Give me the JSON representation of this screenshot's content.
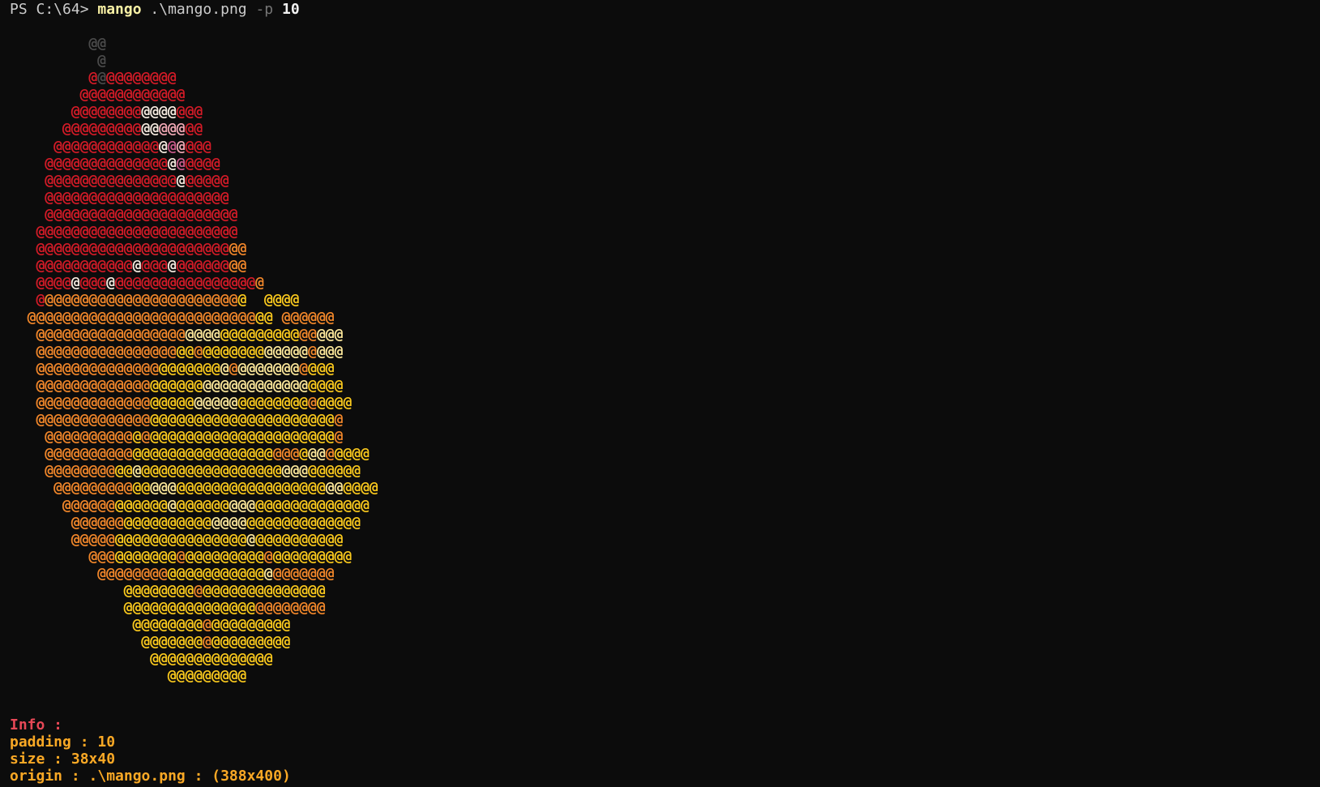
{
  "prompt": {
    "path": "PS C:\\64> ",
    "command": "mango",
    "arg": ".\\mango.png",
    "flag": "-p",
    "value": "10"
  },
  "colors": {
    "background": "#0c0c0c",
    "grey": "#555555",
    "red": "#d7191e",
    "pink": "#e89aa2",
    "orange": "#f28c1e",
    "yellow": "#fcd116",
    "light": "#fff3d6"
  },
  "ascii_art": {
    "char": "@",
    "palette": {
      "g": "#4a4a4a",
      "r": "#d21b27",
      "p": "#f0a8b4",
      "m": "#c95a8a",
      "w": "#f5eadf",
      "o": "#f0862a",
      "y": "#f9c81d",
      "L": "#fce79a"
    },
    "rows": [
      {
        "indent": 9,
        "cells": "gg"
      },
      {
        "indent": 10,
        "cells": "g"
      },
      {
        "indent": 9,
        "cells": "rgrrrrrrrr"
      },
      {
        "indent": 8,
        "cells": "rrrrrrrrrrrr"
      },
      {
        "indent": 7,
        "cells": "rrrrrrrrwwwwrrr"
      },
      {
        "indent": 6,
        "cells": "rrrrrrrrrwwppprr"
      },
      {
        "indent": 5,
        "cells": "rrrrrrrrrrrrwmprrr"
      },
      {
        "indent": 4,
        "cells": "rrrrrrrrrrrrrrwmrrrr"
      },
      {
        "indent": 4,
        "cells": "rrrrrrrrrrrrrrrwrrrrr"
      },
      {
        "indent": 4,
        "cells": "rrrrrrrrrrrrrrrrrrrrr"
      },
      {
        "indent": 4,
        "cells": "rrrrrrrrrrrrrrrrrrrrrr"
      },
      {
        "indent": 3,
        "cells": "rrrrrrrrrrrrrrrrrrrrrrr"
      },
      {
        "indent": 3,
        "cells": "rrrrrrrrrrrrrrrrrrrrrroo"
      },
      {
        "indent": 3,
        "cells": "rrrrrrrrrrrwrrrwrrrrrroo"
      },
      {
        "indent": 3,
        "cells": "rrrrwrrrwrrrrrrrrrrrrrrrro"
      },
      {
        "indent": 3,
        "cells": "rooooooooooooooooooooooy  yyyy"
      },
      {
        "indent": 2,
        "cells": "ooooooooooooooooooooooooooyy oooooo"
      },
      {
        "indent": 3,
        "cells": "oooooooooooooooooLLLLyyyyyyyyyooLLL"
      },
      {
        "indent": 3,
        "cells": "ooooooooooooooooyyoyyyyyyyLLLLLoLLL"
      },
      {
        "indent": 3,
        "cells": "ooooooooooooooyyyyyyyLoLLLLLLLoyyy"
      },
      {
        "indent": 3,
        "cells": "oooooooooooooyyyyyyLLLLLLLLLLLLyyyy"
      },
      {
        "indent": 3,
        "cells": "oooooooooooooyyyyyLLLLLyyyyyyyyoyyyy"
      },
      {
        "indent": 3,
        "cells": "oooooooooooooyyyyyyyyyyyyyyyyyyyyyo"
      },
      {
        "indent": 4,
        "cells": "ooooooooooyoyyyyyyyyyyyyyyyyyyyyyo"
      },
      {
        "indent": 4,
        "cells": "ooooooooooyyyyyyyyyyyyyyyyoooyLLoyyyy"
      },
      {
        "indent": 4,
        "cells": "ooooooooyyLyyyyyyyyyyyyyyyyLLLyyyyyy"
      },
      {
        "indent": 5,
        "cells": "oooooooooyyLLLyyyyyyyyyyyyyyyyyLLyyyy"
      },
      {
        "indent": 6,
        "cells": "ooooooyyyyyyLyyyyyyLLLyyyyyyyyyyyyy"
      },
      {
        "indent": 7,
        "cells": "ooooooyyyyyyyyyyLLLLyyyyyyyyyyyyy"
      },
      {
        "indent": 7,
        "cells": "oooooyyyyyyyyyyyyyyyLyyyyyyyyyy"
      },
      {
        "indent": 9,
        "cells": "oooyyyyyyyoyyyyyyyyyoyyyyyyyyy"
      },
      {
        "indent": 10,
        "cells": "ooooooooyyyyyyyyyyyLooooooo"
      },
      {
        "indent": 13,
        "cells": "yyyyyyyyoyyyyyyyyyyyyyy"
      },
      {
        "indent": 13,
        "cells": "yyyyyyyyyyyyyyyoooooooo"
      },
      {
        "indent": 14,
        "cells": "yyyyyyyyoyyyyyyyyy"
      },
      {
        "indent": 15,
        "cells": "yyyyyyyoyyyyyyyyy"
      },
      {
        "indent": 16,
        "cells": "yyyyyyyyyyyyyy"
      },
      {
        "indent": 18,
        "cells": "yyyyyyyyy"
      }
    ]
  },
  "info": {
    "title": "Info :",
    "padding": "padding : 10",
    "size": "size : 38x40",
    "origin": "origin : .\\mango.png : (388x400)"
  }
}
